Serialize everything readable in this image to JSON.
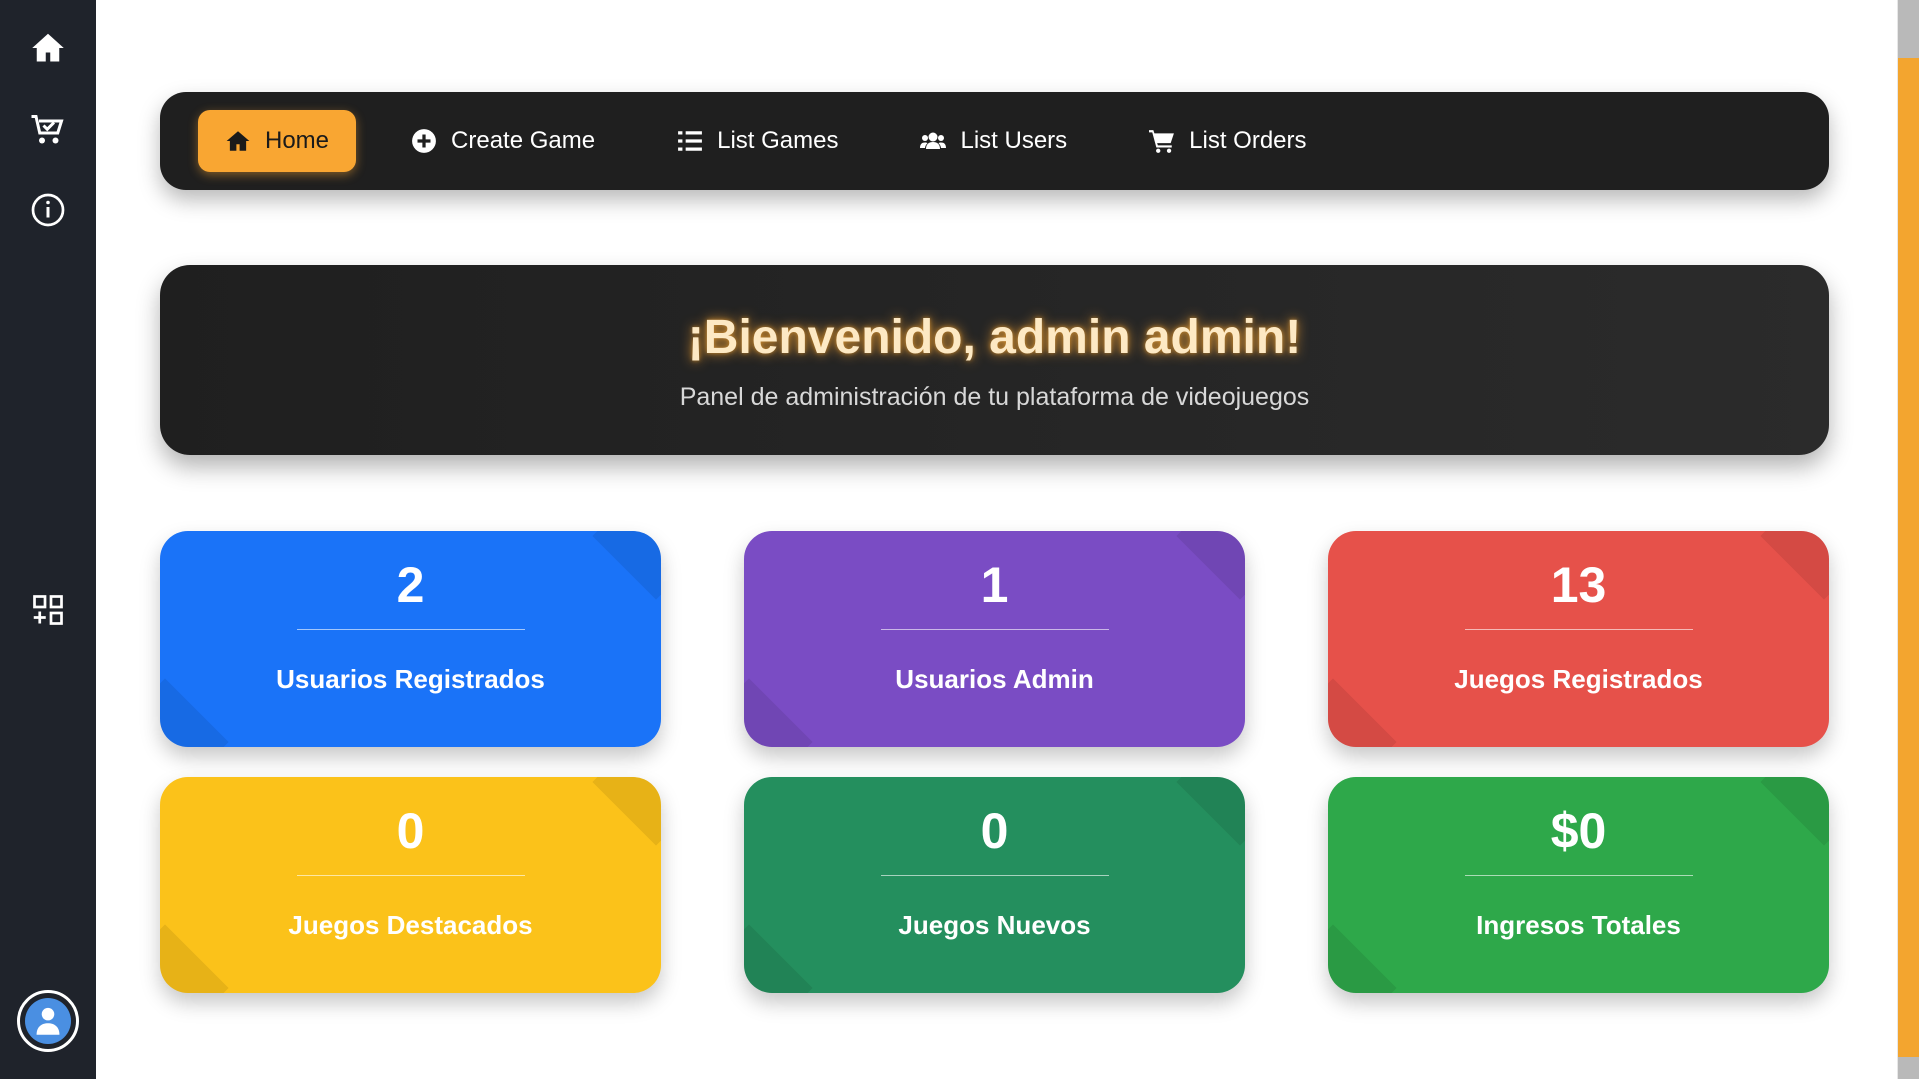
{
  "nav": {
    "items": [
      {
        "label": "Home",
        "icon": "home-icon",
        "active": true
      },
      {
        "label": "Create Game",
        "icon": "plus-circle-icon",
        "active": false
      },
      {
        "label": "List Games",
        "icon": "list-icon",
        "active": false
      },
      {
        "label": "List Users",
        "icon": "users-icon",
        "active": false
      },
      {
        "label": "List Orders",
        "icon": "cart-icon",
        "active": false
      }
    ]
  },
  "sidebar": {
    "items": [
      "home-icon",
      "cart-check-icon",
      "info-icon",
      "grid-plus-icon"
    ],
    "avatar": "user-avatar-icon"
  },
  "banner": {
    "title": "¡Bienvenido, admin admin!",
    "subtitle": "Panel de administración de tu plataforma de videojuegos"
  },
  "stats": [
    {
      "value": "2",
      "label": "Usuarios Registrados",
      "color": "#1a73f8"
    },
    {
      "value": "1",
      "label": "Usuarios Admin",
      "color": "#7a4cc4"
    },
    {
      "value": "13",
      "label": "Juegos Registrados",
      "color": "#e6514a"
    },
    {
      "value": "0",
      "label": "Juegos Destacados",
      "color": "#fbc21a"
    },
    {
      "value": "0",
      "label": "Juegos Nuevos",
      "color": "#248f5e"
    },
    {
      "value": "$0",
      "label": "Ingresos Totales",
      "color": "#2ea84a"
    }
  ],
  "colors": {
    "accent": "#f9a632",
    "sidebar": "#1f232b",
    "nav_bg": "#1f1f1f"
  }
}
